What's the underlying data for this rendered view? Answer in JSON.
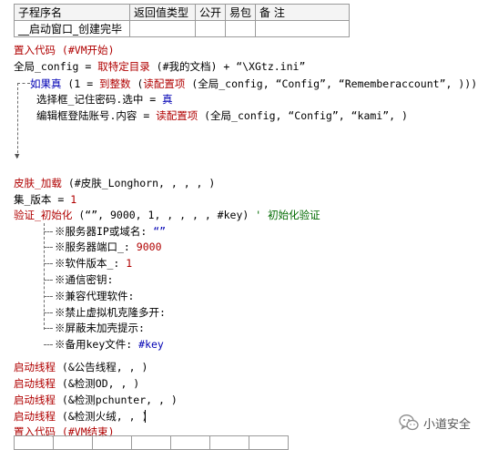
{
  "table": {
    "headers": [
      "子程序名",
      "返回值类型",
      "公开",
      "易包",
      "备 注"
    ],
    "row": [
      "__启动窗口_创建完毕",
      "",
      "",
      "",
      ""
    ]
  },
  "code": {
    "l1": "置入代码 (#VM开始)",
    "l2a": "全局_config = ",
    "l2b": "取特定目录",
    "l2c": " (#我的文档) + “\\XGtz.ini”",
    "l3a": "如果真",
    "l3b": " (1 = ",
    "l3c": "到整数",
    "l3d": " (",
    "l3e": "读配置项",
    "l3f": " (全局_config, “Config”, “Rememberaccount”, )))",
    "l4a": "选择框_记住密码.选中 = ",
    "l4b": "真",
    "l5a": "编辑框登陆账号.内容 = ",
    "l5b": "读配置项",
    "l5c": " (全局_config, “Config”, “kami”, )",
    "l6a": "皮肤_加载",
    "l6b": " (#皮肤_Longhorn, , , , )",
    "l7a": "集_版本 = ",
    "l7b": "1",
    "l8a": "验证_初始化",
    "l8b": " (“”, 9000, 1, , , , , #key)",
    "l8c": " ' 初始化验证",
    "params": [
      {
        "label": "※服务器IP或域名:",
        "value": "“”"
      },
      {
        "label": "※服务器端口_:",
        "value": "9000"
      },
      {
        "label": "※软件版本_:",
        "value": "1"
      },
      {
        "label": "※通信密钥:",
        "value": ""
      },
      {
        "label": "※兼容代理软件:",
        "value": ""
      },
      {
        "label": "※禁止虚拟机克隆多开:",
        "value": ""
      },
      {
        "label": "※屏蔽未加壳提示:",
        "value": ""
      },
      {
        "label": "※备用key文件:",
        "value": "#key"
      }
    ],
    "t1a": "启动线程",
    "t1b": " (&公告线程, , )",
    "t2a": "启动线程",
    "t2b": " (&检测OD, , )",
    "t3a": "启动线程",
    "t3b": " (&检测pchunter, , )",
    "t4a": "启动线程",
    "t4b": " (&检测火绒, , )",
    "end": "置入代码 (#VM结束)"
  },
  "watermark": {
    "text": "小道安全",
    "icon": "wechat-logo-icon"
  }
}
